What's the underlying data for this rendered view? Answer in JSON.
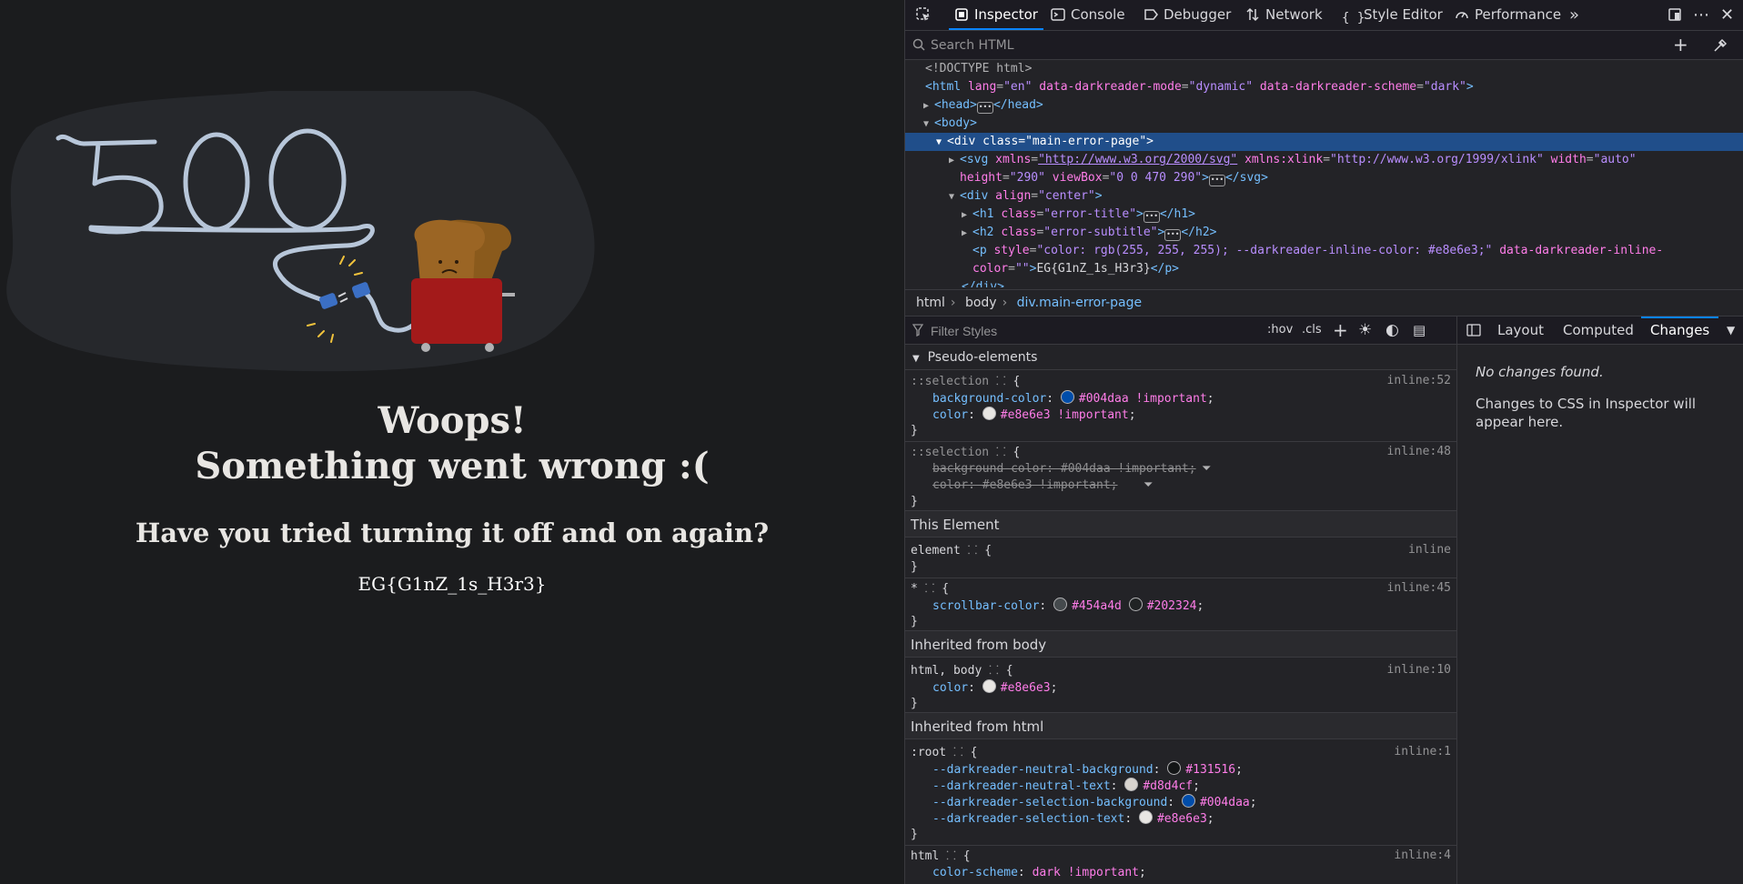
{
  "page": {
    "error_code": "500",
    "title_line1": "Woops!",
    "title_line2": "Something went wrong :(",
    "subtitle": "Have you tried turning it off and on again?",
    "flag": "EG{G1nZ_1s_H3r3}"
  },
  "devtools": {
    "tabs": [
      {
        "label": "Inspector",
        "icon": "inspector-icon",
        "active": true
      },
      {
        "label": "Console",
        "icon": "console-icon"
      },
      {
        "label": "Debugger",
        "icon": "debugger-icon"
      },
      {
        "label": "Network",
        "icon": "network-icon"
      },
      {
        "label": "Style Editor",
        "icon": "style-editor-icon"
      },
      {
        "label": "Performance",
        "icon": "performance-icon"
      }
    ],
    "search_placeholder": "Search HTML",
    "markup": {
      "doctype": "<!DOCTYPE html>",
      "html_open_tag": "<html",
      "html_attr1_name": "lang",
      "html_attr1_val": "\"en\"",
      "html_attr2_name": "data-darkreader-mode",
      "html_attr2_val": "\"dynamic\"",
      "html_attr3_name": "data-darkreader-scheme",
      "html_attr3_val": "\"dark\"",
      "head": "<head>",
      "head_close": "</head>",
      "body": "<body>",
      "div_main": "<div class=\"main-error-page\">",
      "svg_open": "<svg",
      "svg_xmlns_name": "xmlns",
      "svg_xmlns_val": "\"http://www.w3.org/2000/svg\"",
      "svg_xlink_name": "xmlns:xlink",
      "svg_xlink_val": "\"http://www.w3.org/1999/xlink\"",
      "svg_width_name": "width",
      "svg_width_val": "\"auto\"",
      "svg_height_name": "height",
      "svg_height_val": "\"290\"",
      "svg_viewbox_name": "viewBox",
      "svg_viewbox_val": "\"0 0 470 290\"",
      "svg_close": "</svg>",
      "div_center_open": "<div",
      "div_center_attr": "align",
      "div_center_val": "\"center\"",
      "h1_open": "<h1",
      "h1_attr": "class",
      "h1_val": "\"error-title\"",
      "h1_close": "</h1>",
      "h2_open": "<h2",
      "h2_attr": "class",
      "h2_val": "\"error-subtitle\"",
      "h2_close": "</h2>",
      "p_open": "<p",
      "p_attr1": "style",
      "p_val1": "\"color: rgb(255, 255, 255); --darkreader-inline-color: #e8e6e3;\"",
      "p_attr2": "data-darkreader-inline-",
      "p_attr2b": "color",
      "p_val2": "\"\"",
      "p_text": "EG{G1nZ_1s_H3r3}",
      "p_close": "</p>",
      "div_close": "</div>"
    },
    "breadcrumbs": [
      "html",
      "body",
      "div.main-error-page"
    ],
    "filter_placeholder": "Filter Styles",
    "hov": ":hov",
    "cls": ".cls",
    "sections": {
      "pseudo": "Pseudo-elements",
      "this_element": "This Element",
      "inherited_body": "Inherited from body",
      "inherited_html": "Inherited from html"
    },
    "rules": {
      "sel1": "::selection",
      "sel1_src": "inline:52",
      "sel1_p1_name": "background-color",
      "sel1_p1_val": "#004daa !important",
      "sel1_p2_name": "color",
      "sel1_p2_val": "#e8e6e3 !important",
      "sel2": "::selection",
      "sel2_src": "inline:48",
      "sel2_p1": "background-color: #004daa !important;",
      "sel2_p2": "color: #e8e6e3 !important;",
      "element": "element",
      "element_src": "inline",
      "star": "*",
      "star_src": "inline:45",
      "star_p_name": "scrollbar-color",
      "star_p_val1": "#454a4d",
      "star_p_val2": "#202324",
      "htmlbody": "html, body",
      "htmlbody_src": "inline:10",
      "htmlbody_p_name": "color",
      "htmlbody_p_val": "#e8e6e3",
      "root": ":root",
      "root_src": "inline:1",
      "root_p1_name": "--darkreader-neutral-background",
      "root_p1_val": "#131516",
      "root_p2_name": "--darkreader-neutral-text",
      "root_p2_val": "#d8d4cf",
      "root_p3_name": "--darkreader-selection-background",
      "root_p3_val": "#004daa",
      "root_p4_name": "--darkreader-selection-text",
      "root_p4_val": "#e8e6e3",
      "html": "html",
      "html_src": "inline:4",
      "html_p_name": "color-scheme",
      "html_p_val": "dark !important"
    },
    "side_tabs": [
      "Layout",
      "Computed",
      "Changes"
    ],
    "no_changes": "No changes found.",
    "changes_desc": "Changes to CSS in Inspector will appear here.",
    "colors": {
      "accent": "#0a84ff",
      "selection": "#204e8a",
      "swatch_blue": "#004daa",
      "swatch_light": "#e8e6e3",
      "swatch_dark1": "#454a4d",
      "swatch_dark2": "#202324",
      "swatch_bg": "#131516",
      "swatch_text": "#d8d4cf"
    }
  }
}
